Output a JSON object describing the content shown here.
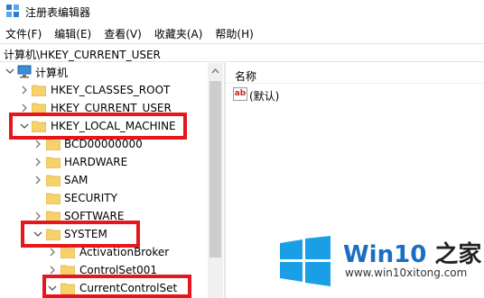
{
  "window": {
    "title": "注册表编辑器",
    "icon": "regedit-icon"
  },
  "menu": [
    "文件(F)",
    "编辑(E)",
    "查看(V)",
    "收藏夹(A)",
    "帮助(H)"
  ],
  "address": "计算机\\HKEY_CURRENT_USER",
  "tree": {
    "root": "计算机",
    "nodes": {
      "hkcr": "HKEY_CLASSES_ROOT",
      "hkcu": "HKEY_CURRENT_USER",
      "hklm": "HKEY_LOCAL_MACHINE",
      "bcd": "BCD00000000",
      "hardware": "HARDWARE",
      "sam": "SAM",
      "security": "SECURITY",
      "software": "SOFTWARE",
      "system": "SYSTEM",
      "activation": "ActivationBroker",
      "controlset001": "ControlSet001",
      "currentcontrolset": "CurrentControlSet"
    }
  },
  "list": {
    "header_name": "名称",
    "values": [
      {
        "icon": "ab",
        "name": "(默认)"
      }
    ]
  },
  "watermark": {
    "brand_prefix": "Win10",
    "brand_suffix": " 之家",
    "url": "www.win10xitong.com"
  },
  "colors": {
    "highlight_red": "#e6161c",
    "folder_yellow": "#f7d26b",
    "logo_blue": "#1a9fe6",
    "brand_text": "#1a6ec4"
  }
}
